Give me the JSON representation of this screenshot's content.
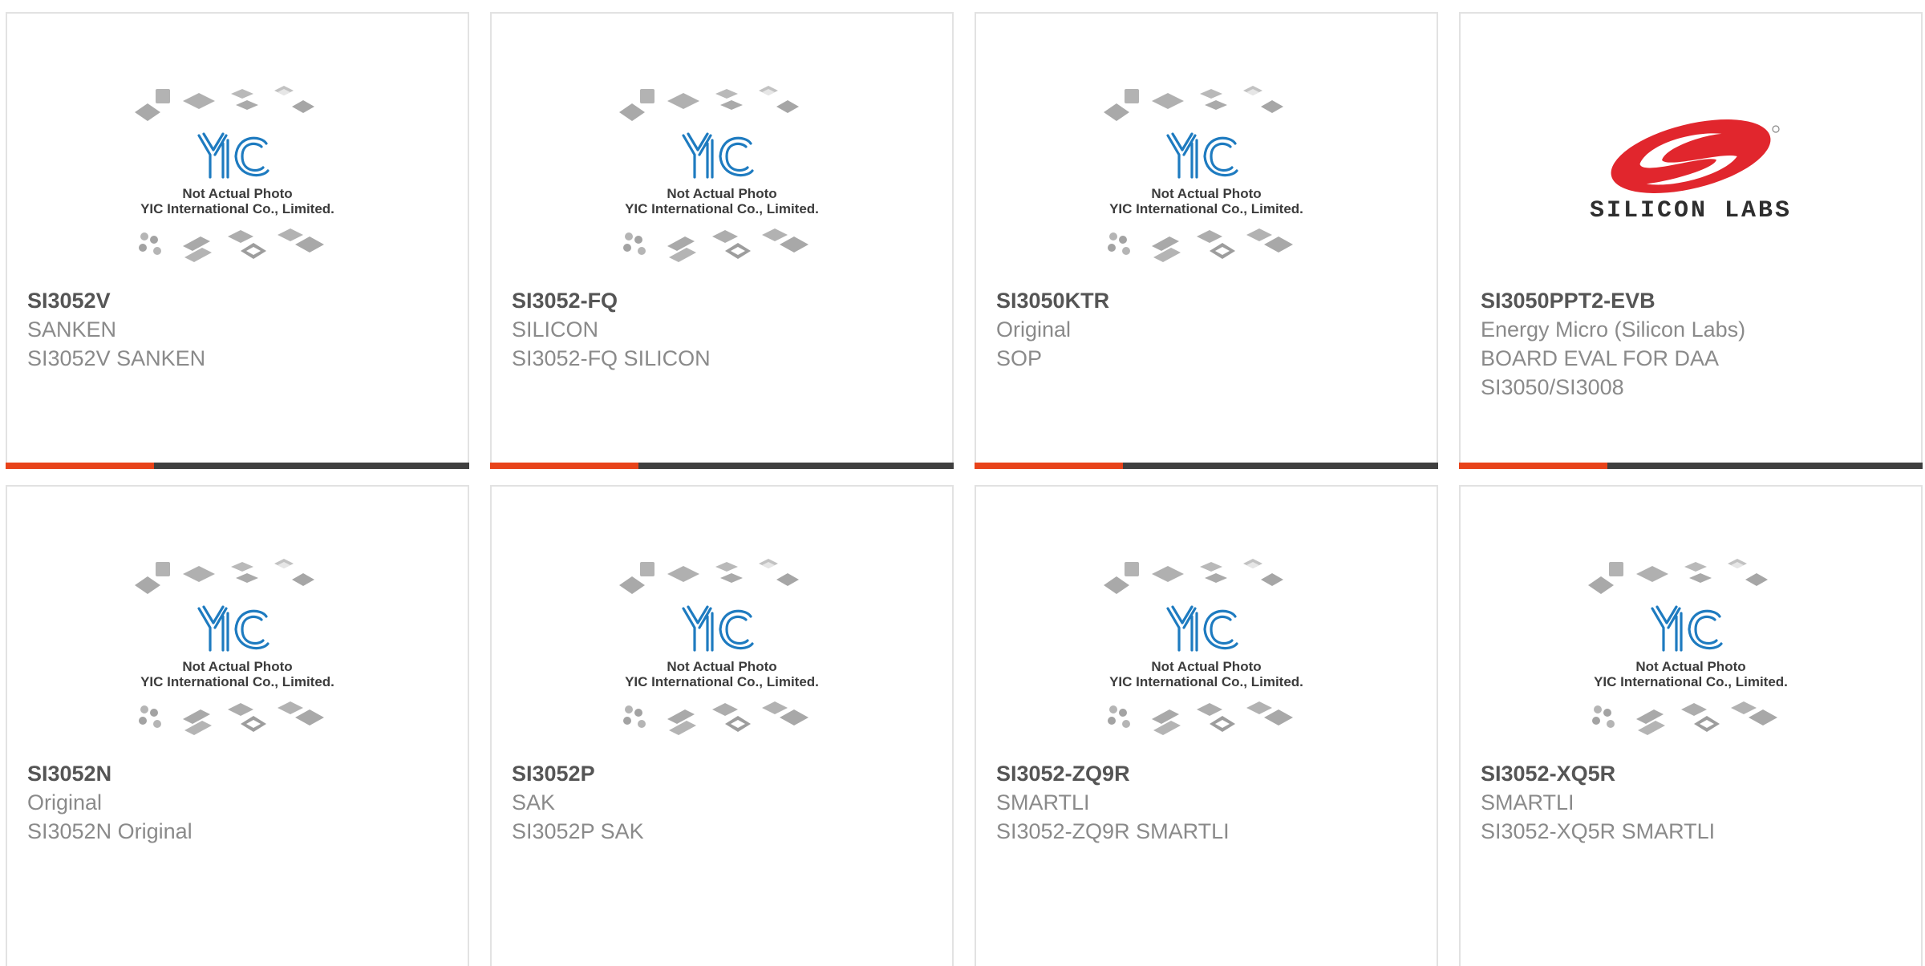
{
  "placeholder": {
    "caption_line1": "Not Actual Photo",
    "caption_line2": "YIC International Co., Limited.",
    "logo_text": "YIC"
  },
  "brand_logo": {
    "text": "SILICON LABS"
  },
  "colors": {
    "accent": "#e8431a",
    "bar_dark": "#3f3f3f",
    "logo_red": "#e1262d",
    "yic_blue": "#1e7bc0"
  },
  "products": [
    {
      "part": "SI3052V",
      "brand": "SANKEN",
      "desc": "SI3052V SANKEN",
      "desc2": "",
      "image": "yic-placeholder"
    },
    {
      "part": "SI3052-FQ",
      "brand": "SILICON",
      "desc": "SI3052-FQ SILICON",
      "desc2": "",
      "image": "yic-placeholder"
    },
    {
      "part": "SI3050KTR",
      "brand": "Original",
      "desc": "SOP",
      "desc2": "",
      "image": "yic-placeholder"
    },
    {
      "part": "SI3050PPT2-EVB",
      "brand": "Energy Micro (Silicon Labs)",
      "desc": "BOARD EVAL FOR DAA",
      "desc2": "SI3050/SI3008",
      "image": "silicon-labs-logo"
    },
    {
      "part": "SI3052N",
      "brand": "Original",
      "desc": "SI3052N Original",
      "desc2": "",
      "image": "yic-placeholder"
    },
    {
      "part": "SI3052P",
      "brand": "SAK",
      "desc": "SI3052P SAK",
      "desc2": "",
      "image": "yic-placeholder"
    },
    {
      "part": "SI3052-ZQ9R",
      "brand": "SMARTLI",
      "desc": "SI3052-ZQ9R SMARTLI",
      "desc2": "",
      "image": "yic-placeholder"
    },
    {
      "part": "SI3052-XQ5R",
      "brand": "SMARTLI",
      "desc": "SI3052-XQ5R SMARTLI",
      "desc2": "",
      "image": "yic-placeholder"
    }
  ]
}
